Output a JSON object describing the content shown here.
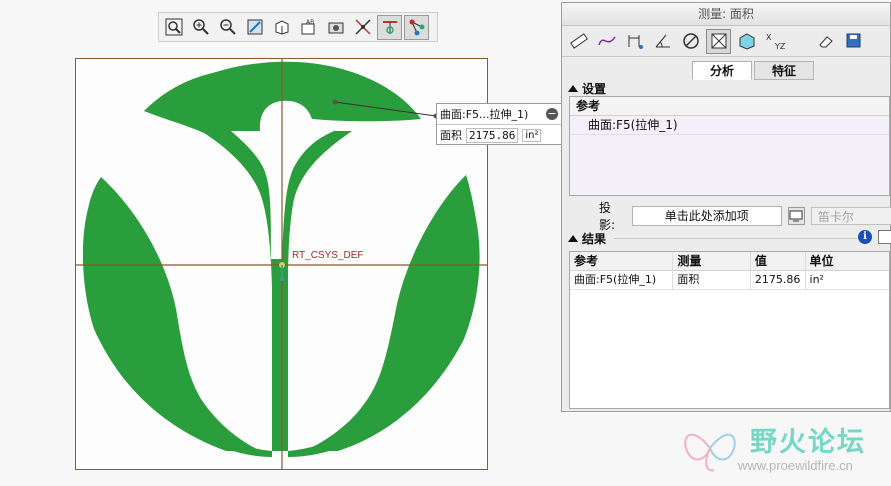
{
  "toolbar": {
    "icons": [
      "zoom-fit-icon",
      "zoom-in-icon",
      "zoom-out-icon",
      "repaint-icon",
      "orientation-icon",
      "saved-views-icon",
      "display-style-icon",
      "datum-display-icon",
      "spin-center-icon",
      "annotation-display-icon"
    ]
  },
  "viewport": {
    "csys_label": "RT_CSYS_DEF",
    "logo_color": "#2a9d3c",
    "axis_color": "#8b5a2b"
  },
  "callout": {
    "surface_label": "曲面:F5...拉伸_1)",
    "area_label": "面积",
    "area_value": "2175.86",
    "unit": "in²"
  },
  "panel": {
    "title": "测量: 面积",
    "tabs": [
      {
        "label": "分析"
      },
      {
        "label": "特征"
      }
    ],
    "setup": {
      "header": "设置",
      "ref_header": "参考",
      "ref_item": "曲面:F5(拉伸_1)",
      "projection_label": "投影:",
      "projection_button": "单击此处添加项",
      "coord_system": "笛卡尔"
    },
    "results": {
      "header": "结果",
      "columns": [
        "参考",
        "测量",
        "值",
        "单位"
      ],
      "rows": [
        [
          "曲面:F5(拉伸_1)",
          "面积",
          "2175.86",
          "in²"
        ]
      ]
    }
  },
  "watermark": {
    "title": "野火论坛",
    "url": "www.proewildfire.cn"
  }
}
